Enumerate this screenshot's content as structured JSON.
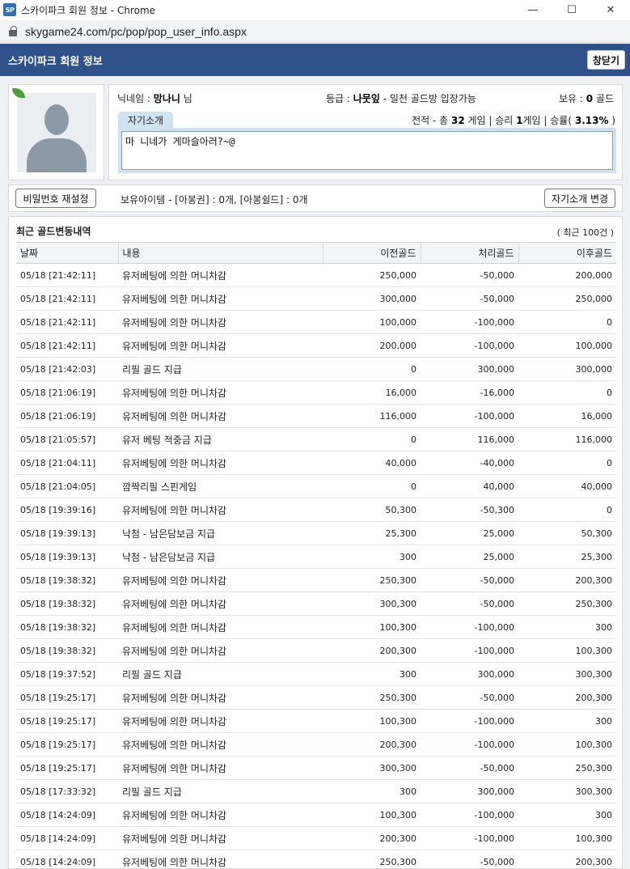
{
  "window": {
    "app_icon": "SP",
    "title": "스카이파크 회원 정보 - Chrome",
    "url": "skygame24.com/pc/pop/pop_user_info.aspx",
    "minimize": "—",
    "maximize": "☐",
    "close": "✕"
  },
  "header": {
    "title": "스카이파크 회원 정보",
    "close_label": "창닫기"
  },
  "profile": {
    "nick_label": "닉네임 : ",
    "nick": "망나니",
    "nick_suffix": " 님",
    "grade_label": "등급 : ",
    "grade": "나뭇잎",
    "grade_desc": " - 일천 골드방 입장가능",
    "owned_label": "보유 : ",
    "owned_value": "0",
    "owned_unit": " 골드",
    "intro_tab": "자기소개",
    "record_prefix": "전적 - 총 ",
    "total_games": "32",
    "record_mid": " 게임 | 승리 ",
    "wins": "1",
    "record_mid2": "게임 | 승률( ",
    "win_rate": "3.13%",
    "record_end": " )",
    "intro_text": "마 니네가 게마슬아러?~@"
  },
  "actions": {
    "password_reset": "비밀번호 재설정",
    "items": "보유아이템 - [아봉권] : 0개, [아봉쉴드] : 0개",
    "intro_change": "자기소개 변경"
  },
  "history": {
    "title": "최근 골드변동내역",
    "count": "( 최근 100건 )",
    "columns": [
      "날짜",
      "내용",
      "이전골드",
      "처리골드",
      "이후골드"
    ],
    "rows": [
      [
        "05/18 [21:42:11]",
        "유저베팅에 의한 머니차감",
        "250,000",
        "-50,000",
        "200,000"
      ],
      [
        "05/18 [21:42:11]",
        "유저베팅에 의한 머니차감",
        "300,000",
        "-50,000",
        "250,000"
      ],
      [
        "05/18 [21:42:11]",
        "유저베팅에 의한 머니차감",
        "100,000",
        "-100,000",
        "0"
      ],
      [
        "05/18 [21:42:11]",
        "유저베팅에 의한 머니차감",
        "200,000",
        "-100,000",
        "100,000"
      ],
      [
        "05/18 [21:42:03]",
        "리필 골드 지급",
        "0",
        "300,000",
        "300,000"
      ],
      [
        "05/18 [21:06:19]",
        "유저베팅에 의한 머니차감",
        "16,000",
        "-16,000",
        "0"
      ],
      [
        "05/18 [21:06:19]",
        "유저베팅에 의한 머니차감",
        "116,000",
        "-100,000",
        "16,000"
      ],
      [
        "05/18 [21:05:57]",
        "유저 베팅 적중금 지급",
        "0",
        "116,000",
        "116,000"
      ],
      [
        "05/18 [21:04:11]",
        "유저베팅에 의한 머니차감",
        "40,000",
        "-40,000",
        "0"
      ],
      [
        "05/18 [21:04:05]",
        "깜짝리필 스핀게임",
        "0",
        "40,000",
        "40,000"
      ],
      [
        "05/18 [19:39:16]",
        "유저베팅에 의한 머니차감",
        "50,300",
        "-50,300",
        "0"
      ],
      [
        "05/18 [19:39:13]",
        "낙첨 - 남은담보금 지급",
        "25,300",
        "25,000",
        "50,300"
      ],
      [
        "05/18 [19:39:13]",
        "낙첨 - 남은담보금 지급",
        "300",
        "25,000",
        "25,300"
      ],
      [
        "05/18 [19:38:32]",
        "유저베팅에 의한 머니차감",
        "250,300",
        "-50,000",
        "200,300"
      ],
      [
        "05/18 [19:38:32]",
        "유저베팅에 의한 머니차감",
        "300,300",
        "-50,000",
        "250,300"
      ],
      [
        "05/18 [19:38:32]",
        "유저베팅에 의한 머니차감",
        "100,300",
        "-100,000",
        "300"
      ],
      [
        "05/18 [19:38:32]",
        "유저베팅에 의한 머니차감",
        "200,300",
        "-100,000",
        "100,300"
      ],
      [
        "05/18 [19:37:52]",
        "리필 골드 지급",
        "300",
        "300,000",
        "300,300"
      ],
      [
        "05/18 [19:25:17]",
        "유저베팅에 의한 머니차감",
        "250,300",
        "-50,000",
        "200,300"
      ],
      [
        "05/18 [19:25:17]",
        "유저베팅에 의한 머니차감",
        "100,300",
        "-100,000",
        "300"
      ],
      [
        "05/18 [19:25:17]",
        "유저베팅에 의한 머니차감",
        "200,300",
        "-100,000",
        "100,300"
      ],
      [
        "05/18 [19:25:17]",
        "유저베팅에 의한 머니차감",
        "300,300",
        "-50,000",
        "250,300"
      ],
      [
        "05/18 [17:33:32]",
        "리필 골드 지급",
        "300",
        "300,000",
        "300,300"
      ],
      [
        "05/18 [14:24:09]",
        "유저베팅에 의한 머니차감",
        "100,300",
        "-100,000",
        "300"
      ],
      [
        "05/18 [14:24:09]",
        "유저베팅에 의한 머니차감",
        "200,300",
        "-100,000",
        "100,300"
      ],
      [
        "05/18 [14:24:09]",
        "유저베팅에 의한 머니차감",
        "250,300",
        "-50,000",
        "200,300"
      ]
    ]
  }
}
